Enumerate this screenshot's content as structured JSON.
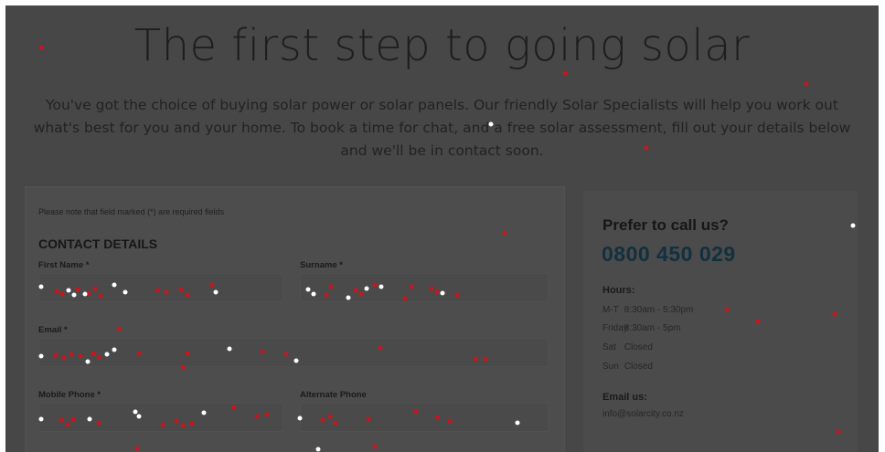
{
  "headline": "The first step to going solar",
  "intro": "You've got the choice of buying solar power or solar panels. Our friendly Solar Specialists will help you work out what's best for you and your home. To book a time for chat, and a free solar assessment, fill out your details below and we'll be in contact soon.",
  "form": {
    "note": "Please note that field marked (*) are required fields",
    "section_title": "CONTACT DETAILS",
    "fields": {
      "first_name": "First Name *",
      "surname": "Surname *",
      "email": "Email *",
      "mobile_phone": "Mobile Phone *",
      "alternate_phone": "Alternate Phone"
    }
  },
  "contact": {
    "title": "Prefer to call us?",
    "phone": "0800 450 029",
    "hours_title": "Hours:",
    "hours": [
      {
        "day": "M-T",
        "time": "8:30am - 5:30pm"
      },
      {
        "day": "Friday",
        "time": "8:30am - 5pm"
      },
      {
        "day": "Sat",
        "time": "Closed"
      },
      {
        "day": "Sun",
        "time": "Closed"
      }
    ],
    "email_title": "Email us:",
    "email": "info@solarcity.co.nz"
  },
  "colors": {
    "overlay": "#474747",
    "phone": "#12303f",
    "dot_red": "#c8161e",
    "dot_white": "#ffffff"
  }
}
